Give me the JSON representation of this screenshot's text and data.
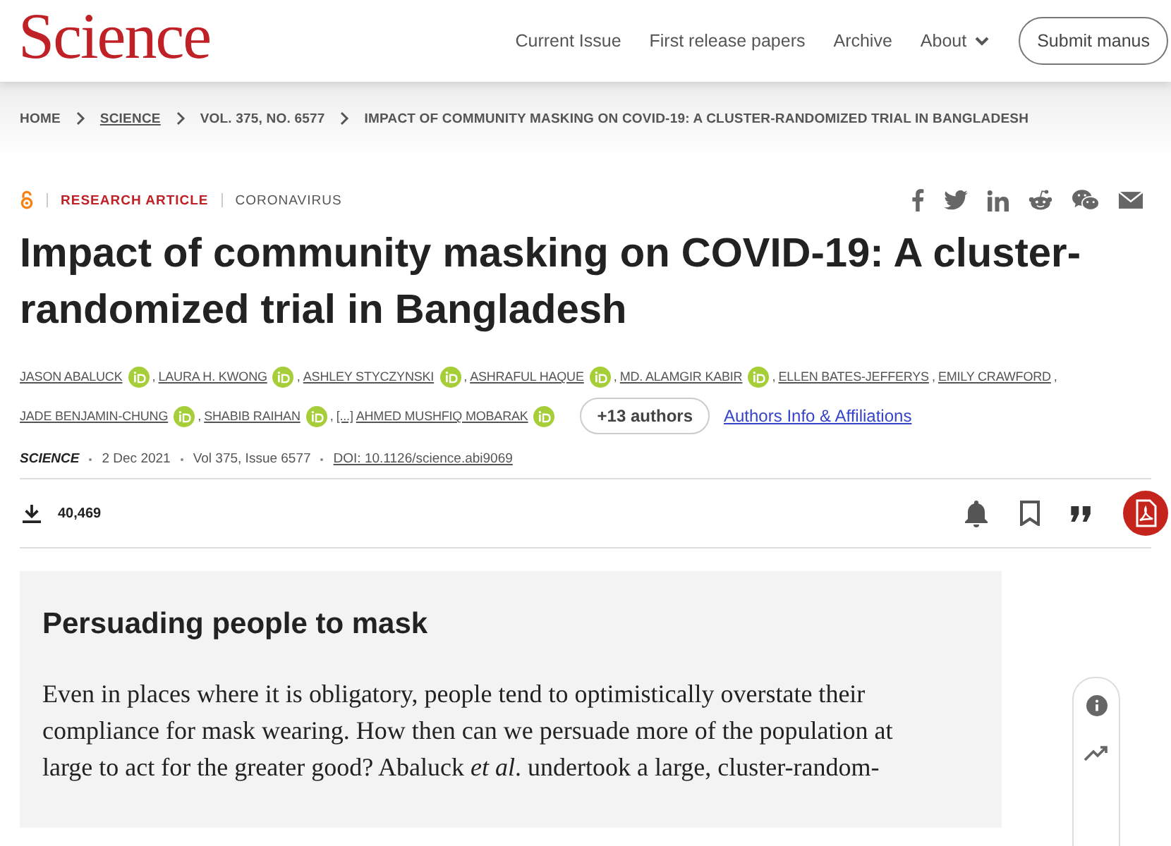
{
  "header": {
    "logo": "Science",
    "nav": [
      {
        "label": "Current Issue",
        "dropdown": false
      },
      {
        "label": "First release papers",
        "dropdown": false
      },
      {
        "label": "Archive",
        "dropdown": false
      },
      {
        "label": "About",
        "dropdown": true
      }
    ],
    "submit_button": "Submit manus"
  },
  "breadcrumb": [
    {
      "label": "HOME",
      "link": false
    },
    {
      "label": "SCIENCE",
      "link": true
    },
    {
      "label": "VOL. 375, NO. 6577",
      "link": false
    },
    {
      "label": "IMPACT OF COMMUNITY MASKING ON COVID-19: A CLUSTER-RANDOMIZED TRIAL IN BANGLADESH",
      "link": false
    }
  ],
  "article": {
    "open_access": true,
    "type": "RESEARCH ARTICLE",
    "section": "CORONAVIRUS",
    "title": "Impact of community masking on COVID-19: A cluster-randomized trial in Bangladesh",
    "authors": [
      {
        "kind": "author",
        "name": "JASON ABALUCK",
        "orcid": true,
        "separator": ","
      },
      {
        "kind": "author",
        "name": "LAURA H. KWONG",
        "orcid": true,
        "separator": ","
      },
      {
        "kind": "author",
        "name": "ASHLEY STYCZYNSKI",
        "orcid": true,
        "separator": ","
      },
      {
        "kind": "author",
        "name": "ASHRAFUL HAQUE",
        "orcid": true,
        "separator": ","
      },
      {
        "kind": "author",
        "name": "MD. ALAMGIR KABIR",
        "orcid": true,
        "separator": ","
      },
      {
        "kind": "author",
        "name": "ELLEN BATES-JEFFERYS",
        "orcid": false,
        "separator": ","
      },
      {
        "kind": "author",
        "name": "EMILY CRAWFORD",
        "orcid": false,
        "separator": ","
      },
      {
        "kind": "author",
        "name": "JADE BENJAMIN-CHUNG",
        "orcid": true,
        "separator": ","
      },
      {
        "kind": "author",
        "name": "SHABIB RAIHAN",
        "orcid": true,
        "separator": ","
      },
      {
        "kind": "ellipsis",
        "name": "[...]"
      },
      {
        "kind": "author",
        "name": "AHMED MUSHFIQ MOBARAK",
        "orcid": true
      }
    ],
    "more_authors": "+13 authors",
    "affiliations_link": "Authors Info & Affiliations",
    "journal": "SCIENCE",
    "date": "2 Dec 2021",
    "issue": "Vol 375, Issue 6577",
    "doi": "DOI: 10.1126/science.abi9069",
    "downloads": "40,469"
  },
  "summary": {
    "heading": "Persuading people to mask",
    "lines": [
      "Even in places where it is obligatory, people tend to optimistically overstate their",
      "compliance for mask wearing. How then can we persuade more of the population at",
      "large to act for the greater good? Abaluck *et al*. undertook a large, cluster-random-"
    ]
  }
}
